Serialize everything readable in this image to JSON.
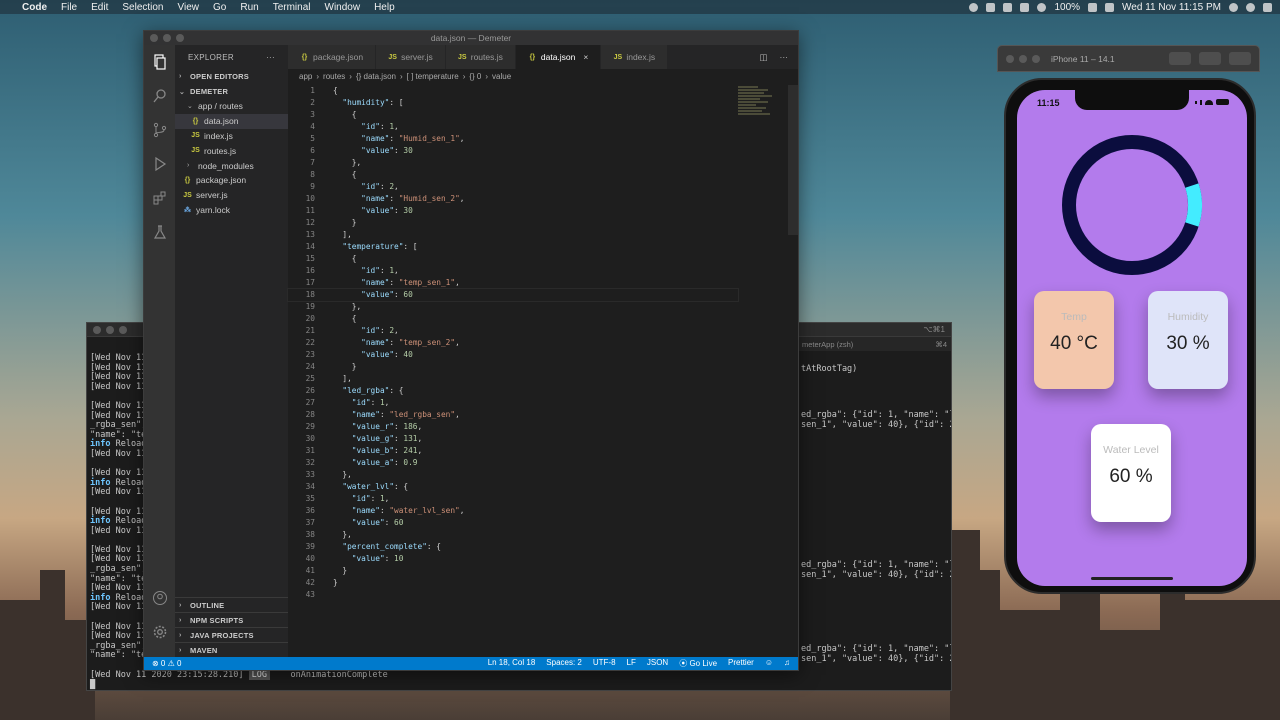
{
  "menubar": {
    "app": "Code",
    "items": [
      "File",
      "Edit",
      "Selection",
      "View",
      "Go",
      "Run",
      "Terminal",
      "Window",
      "Help"
    ],
    "battery": "100%",
    "datetime": "Wed 11 Nov  11:15 PM"
  },
  "vscode": {
    "title": "data.json — Demeter",
    "explorer": {
      "header": "EXPLORER",
      "open_editors": "OPEN EDITORS",
      "project": "DEMETER",
      "folder": "app / routes",
      "files": [
        "data.json",
        "index.js",
        "routes.js"
      ],
      "root": [
        "node_modules",
        "package.json",
        "server.js",
        "yarn.lock"
      ],
      "bottom_sections": [
        "OUTLINE",
        "NPM SCRIPTS",
        "JAVA PROJECTS",
        "MAVEN"
      ]
    },
    "tabs": [
      "package.json",
      "server.js",
      "routes.js",
      "data.json",
      "index.js"
    ],
    "breadcrumb": [
      "app",
      "routes",
      "{} data.json",
      "[ ] temperature",
      "{} 0",
      "value"
    ],
    "status": {
      "problems": "⊗ 0 ⚠ 0",
      "position": "Ln 18, Col 18",
      "spaces": "Spaces: 2",
      "encoding": "UTF-8",
      "eol": "LF",
      "language": "JSON",
      "golive": "Go Live",
      "prettier": "Prettier"
    },
    "code": [
      "{",
      "  \"humidity\": [",
      "    {",
      "      \"id\": 1,",
      "      \"name\": \"Humid_sen_1\",",
      "      \"value\": 30",
      "    },",
      "    {",
      "      \"id\": 2,",
      "      \"name\": \"Humid_sen_2\",",
      "      \"value\": 30",
      "    }",
      "  ],",
      "  \"temperature\": [",
      "    {",
      "      \"id\": 1,",
      "      \"name\": \"temp_sen_1\",",
      "      \"value\": 60",
      "    },",
      "    {",
      "      \"id\": 2,",
      "      \"name\": \"temp_sen_2\",",
      "      \"value\": 40",
      "    }",
      "  ],",
      "  \"led_rgba\": {",
      "    \"id\": 1,",
      "    \"name\": \"led_rgba_sen\",",
      "    \"value_r\": 186,",
      "    \"value_g\": 131,",
      "    \"value_b\": 241,",
      "    \"value_a\": 0.9",
      "  },",
      "  \"water_lvl\": {",
      "    \"id\": 1,",
      "    \"name\": \"water_lvl_sen\",",
      "    \"value\": 60",
      "  },",
      "  \"percent_complete\": {",
      "    \"value\": 10",
      "  }",
      "}",
      ""
    ]
  },
  "left_terminal": {
    "lines": [
      "[Wed Nov 11",
      "[Wed Nov 11",
      "[Wed Nov 11",
      "[Wed Nov 11",
      "",
      "[Wed Nov 11",
      "[Wed Nov 11",
      "_rgba_sen\",",
      "\"name\": \"te",
      "info Reload",
      "[Wed Nov 11",
      "",
      "[Wed Nov 11",
      "info Reload",
      "[Wed Nov 11",
      "",
      "[Wed Nov 11",
      "info Reload",
      "[Wed Nov 11",
      "",
      "[Wed Nov 11",
      "[Wed Nov 11",
      "_rgba_sen\",",
      "\"name\": \"te",
      "[Wed Nov 11",
      "info Reload",
      "[Wed Nov 11",
      "",
      "[Wed Nov 11",
      "[Wed Nov 11",
      "_rgba_sen\",",
      "\"name\": \"te"
    ],
    "last_line_time": "[Wed Nov 11 2020 23:15:28.210]",
    "last_line_tag": "LOG",
    "last_line_msg": "onAnimationComplete"
  },
  "right_terminal": {
    "title": "meterApp (zsh)",
    "shortcut": "⌘4",
    "top_shortcut": "⌥⌘1",
    "lines": [
      "tAtRootTag)",
      "ed_rgba\": {\"id\": 1, \"name\": \"led",
      "sen_1\", \"value\": 40}, {\"id\": 2,",
      "ed_rgba\": {\"id\": 1, \"name\": \"led",
      "sen_1\", \"value\": 40}, {\"id\": 2,",
      "ed_rgba\": {\"id\": 1, \"name\": \"led",
      "sen_1\", \"value\": 40}, {\"id\": 2,"
    ]
  },
  "simulator": {
    "title": "iPhone 11 – 14.1",
    "time": "11:15",
    "progress_percent": 10,
    "ring_color": "#0b0d3e",
    "progress_color": "#43ecff",
    "cards": [
      {
        "label": "Temp",
        "value": "40 °C",
        "bg": "#f3c7ac"
      },
      {
        "label": "Humidity",
        "value": "30 %",
        "bg": "#dfe4f9"
      },
      {
        "label": "Water Level",
        "value": "60 %",
        "bg": "#ffffff"
      }
    ]
  }
}
